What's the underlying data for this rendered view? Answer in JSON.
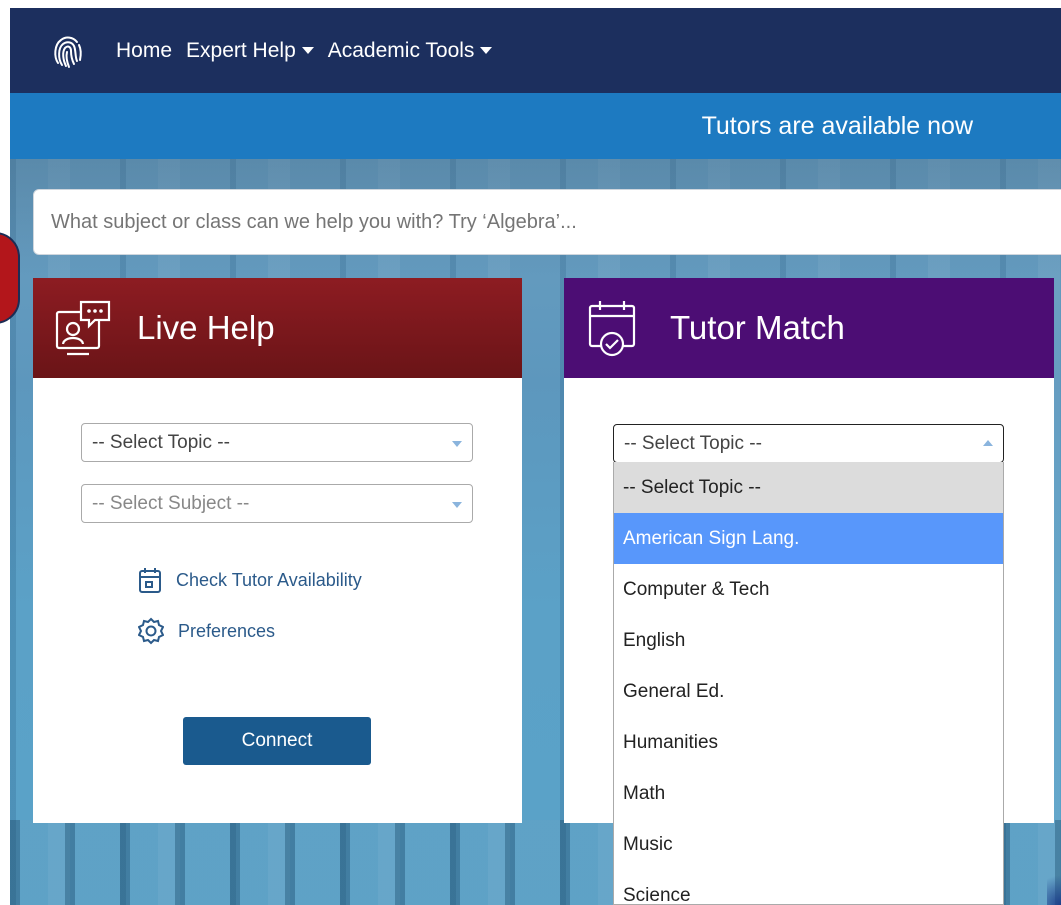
{
  "nav": {
    "home": "Home",
    "expert_help": "Expert Help",
    "academic_tools": "Academic Tools"
  },
  "banner": {
    "text": "Tutors are available now"
  },
  "search": {
    "placeholder": "What subject or class can we help you with? Try ‘Algebra’..."
  },
  "live_help": {
    "title": "Live Help",
    "topic_select": "-- Select Topic --",
    "subject_select": "-- Select Subject --",
    "check_availability": "Check Tutor Availability",
    "preferences": "Preferences",
    "connect": "Connect"
  },
  "tutor_match": {
    "title": "Tutor Match",
    "topic_select": "-- Select Topic --",
    "options": [
      "-- Select Topic --",
      "American Sign Lang.",
      "Computer & Tech",
      "English",
      "General Ed.",
      "Humanities",
      "Math",
      "Music",
      "Science"
    ],
    "highlighted_option": "American Sign Lang."
  },
  "colors": {
    "nav_bg": "#1c2f5e",
    "banner_bg": "#1d7ac1",
    "live_help_header": "#7a181c",
    "tutor_match_header": "#4c0d74",
    "connect_button": "#1a5a8e",
    "dropdown_highlight": "#5897fb"
  },
  "icons": {
    "logo": "fingerprint-logo-icon",
    "live_help": "chat-person-icon",
    "tutor_match": "calendar-check-icon",
    "availability": "calendar-icon",
    "preferences": "gear-icon"
  }
}
